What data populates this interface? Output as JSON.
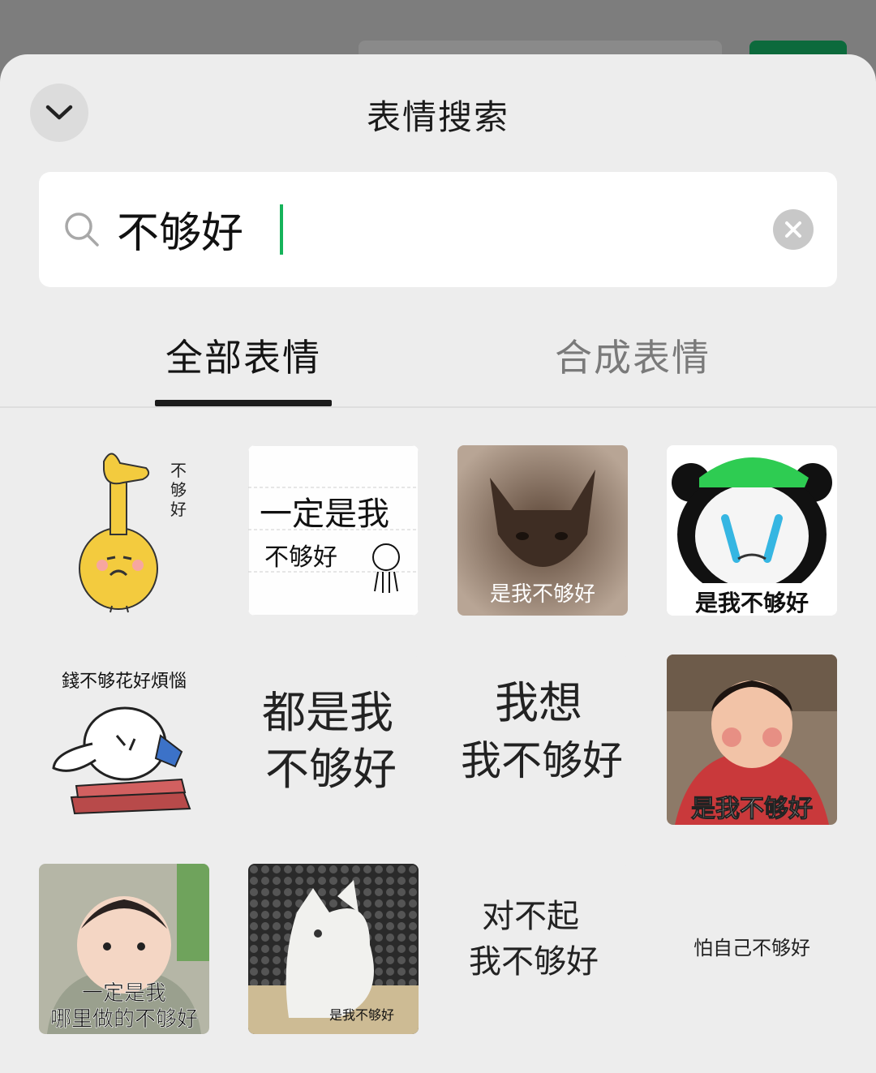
{
  "header": {
    "title": "表情搜索"
  },
  "search": {
    "value": "不够好"
  },
  "tabs": [
    {
      "label": "全部表情",
      "active": true
    },
    {
      "label": "合成表情",
      "active": false
    }
  ],
  "stickers": [
    {
      "caption": "不够好",
      "icon": "thumb-character"
    },
    {
      "caption": "一定是我不够好",
      "icon": "handwritten-note"
    },
    {
      "caption": "是我不够好",
      "icon": "cat-photo"
    },
    {
      "caption": "是我不够好",
      "icon": "panda-face"
    },
    {
      "caption": "錢不够花好煩惱",
      "icon": "rabbit-on-money"
    },
    {
      "caption": "都是我不够好",
      "icon": "text-only"
    },
    {
      "caption": "我想我不够好",
      "icon": "text-only"
    },
    {
      "caption": "是我不够好",
      "icon": "crying-girl-photo"
    },
    {
      "caption": "一定是我哪里做的不够好",
      "icon": "baby-photo"
    },
    {
      "caption": "是我不够好",
      "icon": "white-cat-photo"
    },
    {
      "caption": "对不起我不够好",
      "icon": "text-only"
    },
    {
      "caption": "怕自己不够好",
      "icon": "text-only"
    }
  ],
  "colors": {
    "accent": "#16b35a",
    "sheet": "#ededed"
  }
}
